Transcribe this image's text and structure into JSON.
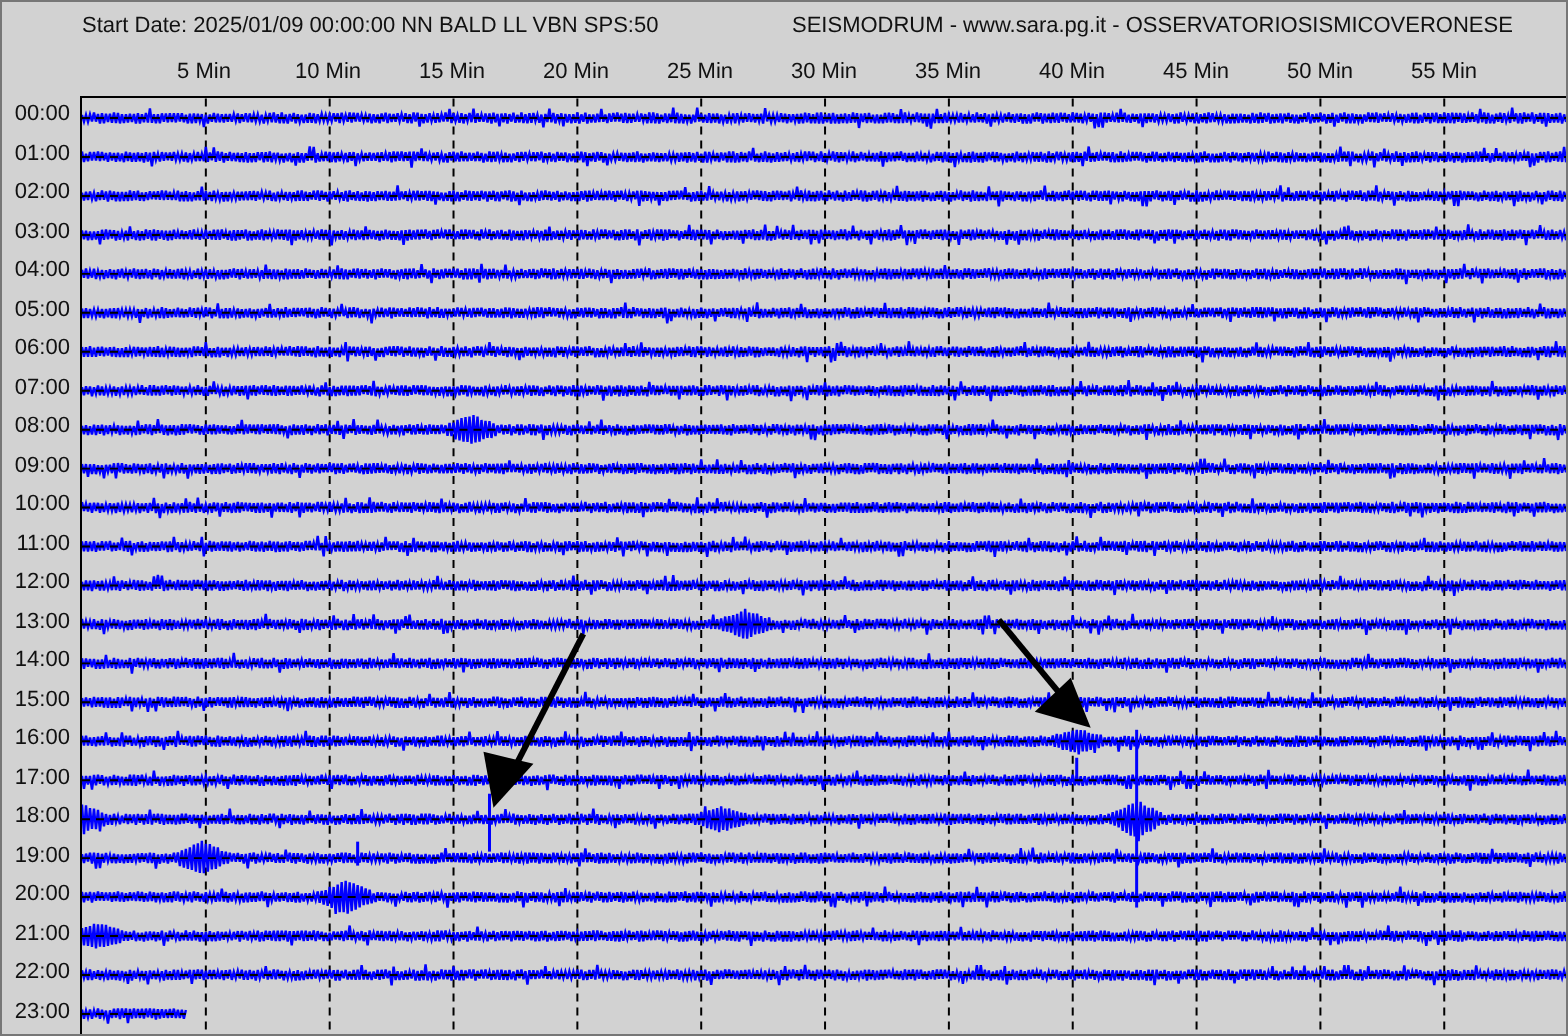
{
  "header": {
    "start_info": "Start Date: 2025/01/09 00:00:00 NN BALD LL VBN SPS:50",
    "station_title": "SEISMODRUM - www.sara.pg.it - OSSERVATORIOSISMICOVERONESE"
  },
  "minute_labels": [
    "5 Min",
    "10 Min",
    "15 Min",
    "20 Min",
    "25 Min",
    "30 Min",
    "35 Min",
    "40 Min",
    "45 Min",
    "50 Min",
    "55 Min"
  ],
  "rows": [
    {
      "label": "00:00",
      "level": 1
    },
    {
      "label": "01:00",
      "level": 1
    },
    {
      "label": "02:00",
      "level": 1
    },
    {
      "label": "03:00",
      "level": 1
    },
    {
      "label": "04:00",
      "level": 1
    },
    {
      "label": "05:00",
      "level": 1
    },
    {
      "label": "06:00",
      "level": 1
    },
    {
      "label": "07:00",
      "level": 1
    },
    {
      "label": "08:00",
      "level": 1
    },
    {
      "label": "09:00",
      "level": 1
    },
    {
      "label": "10:00",
      "level": 1
    },
    {
      "label": "11:00",
      "level": 1
    },
    {
      "label": "12:00",
      "level": 1
    },
    {
      "label": "13:00",
      "level": 1
    },
    {
      "label": "14:00",
      "level": 1
    },
    {
      "label": "15:00",
      "level": 1
    },
    {
      "label": "16:00",
      "level": 1
    },
    {
      "label": "17:00",
      "level": 1
    },
    {
      "label": "18:00",
      "level": 1
    },
    {
      "label": "19:00",
      "level": 1
    },
    {
      "label": "20:00",
      "level": 1
    },
    {
      "label": "21:00",
      "level": 1
    },
    {
      "label": "22:00",
      "level": 1
    },
    {
      "label": "23:00",
      "level": 0.07
    }
  ]
}
